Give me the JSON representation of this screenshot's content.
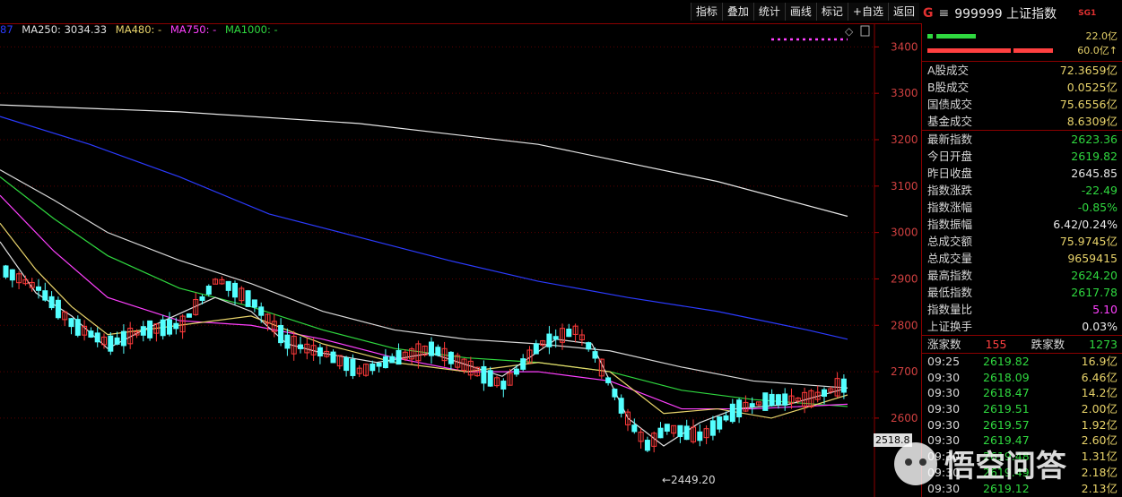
{
  "toolbar": {
    "buttons": [
      "指标",
      "叠加",
      "统计",
      "画线",
      "标记",
      "+自选",
      "返回"
    ]
  },
  "title": {
    "g_letter": "G",
    "code_name": "999999 上证指数",
    "badge": "SG1"
  },
  "legend": {
    "partial": "87",
    "ma250": "MA250: 3034.33",
    "ma480": "MA480: -",
    "ma750": "MA750: -",
    "ma1000": "MA1000: -"
  },
  "axis": {
    "ticks": [
      "3400",
      "3300",
      "3200",
      "3100",
      "3000",
      "2900",
      "2800",
      "2700",
      "2600"
    ]
  },
  "price_tag": "2518.8",
  "min_label": "←2449.20",
  "side": {
    "bar_green_value": "22.0亿",
    "bar_red_value": "60.0亿↑",
    "volumes": [
      {
        "label": "A股成交",
        "value": "72.3659亿"
      },
      {
        "label": "B股成交",
        "value": "0.0525亿"
      },
      {
        "label": "国债成交",
        "value": "75.6556亿"
      },
      {
        "label": "基金成交",
        "value": "8.6309亿"
      }
    ],
    "stats": [
      {
        "label": "最新指数",
        "value": "2623.36",
        "color": "green"
      },
      {
        "label": "今日开盘",
        "value": "2619.82",
        "color": "green"
      },
      {
        "label": "昨日收盘",
        "value": "2645.85",
        "color": "white"
      },
      {
        "label": "指数涨跌",
        "value": "-22.49",
        "color": "green"
      },
      {
        "label": "指数涨幅",
        "value": "-0.85%",
        "color": "green"
      },
      {
        "label": "指数振幅",
        "value": "6.42/0.24%",
        "color": "white"
      },
      {
        "label": "总成交额",
        "value": "75.9745亿",
        "color": "yellow"
      },
      {
        "label": "总成交量",
        "value": "9659415",
        "color": "yellow"
      },
      {
        "label": "最高指数",
        "value": "2624.20",
        "color": "green"
      },
      {
        "label": "最低指数",
        "value": "2617.78",
        "color": "green"
      },
      {
        "label": "指数量比",
        "value": "5.10",
        "color": "magenta"
      },
      {
        "label": "上证换手",
        "value": "0.03%",
        "color": "white"
      }
    ],
    "up_label": "涨家数",
    "up_value": "155",
    "down_label": "跌家数",
    "down_value": "1273",
    "trades": [
      {
        "time": "09:25",
        "price": "2619.82",
        "vol": "16.9亿"
      },
      {
        "time": "09:30",
        "price": "2618.09",
        "vol": "6.46亿"
      },
      {
        "time": "09:30",
        "price": "2618.47",
        "vol": "14.2亿"
      },
      {
        "time": "09:30",
        "price": "2619.51",
        "vol": "2.00亿"
      },
      {
        "time": "09:30",
        "price": "2619.57",
        "vol": "1.92亿"
      },
      {
        "time": "09:30",
        "price": "2619.47",
        "vol": "2.60亿"
      },
      {
        "time": "09:30",
        "price": "2619.48",
        "vol": "1.31亿"
      },
      {
        "time": "09:30",
        "price": "2619.49",
        "vol": "2.18亿"
      },
      {
        "time": "09:30",
        "price": "2619.12",
        "vol": "2.13亿"
      }
    ]
  },
  "watermark": "悟空问答",
  "chart_data": {
    "type": "candlestick",
    "y_axis_ticks": [
      3400,
      3300,
      3200,
      3100,
      3000,
      2900,
      2800,
      2700,
      2600
    ],
    "ylim": [
      2430,
      3420
    ],
    "annotations": [
      "←2449.20",
      "2518.8"
    ],
    "series": [
      {
        "name": "MA250",
        "value": 3034.33
      }
    ]
  },
  "colors": {
    "up": "#ff3b3b",
    "down": "#54ffff",
    "ma_white": "#e0e0e0",
    "ma_yellow": "#e8d36a",
    "ma_magenta": "#ff40ff",
    "ma_green": "#2fd83f",
    "ma_blue": "#2b3bff",
    "grid": "#5a0000"
  }
}
